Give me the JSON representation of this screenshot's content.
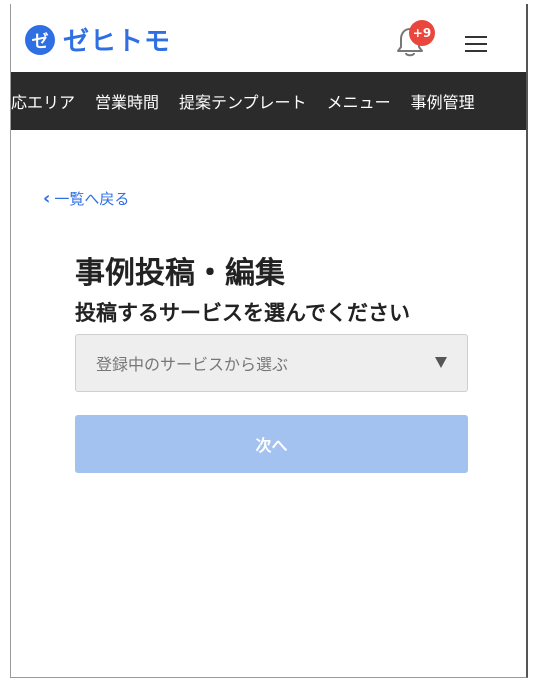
{
  "header": {
    "logo_mark": "ゼ",
    "logo_text": "ゼヒトモ",
    "notification_badge": "+9",
    "icons": [
      "bell-icon",
      "menu-icon"
    ]
  },
  "nav": {
    "items": [
      "対応エリア",
      "営業時間",
      "提案テンプレート",
      "メニュー",
      "事例管理"
    ]
  },
  "content": {
    "back_link": "一覧へ戻る",
    "title": "事例投稿・編集",
    "subtitle": "投稿するサービスを選んでください",
    "select": {
      "placeholder": "登録中のサービスから選ぶ"
    },
    "next_button": "次へ"
  },
  "colors": {
    "brand": "#2f6fe4",
    "nav_bg": "#2b2b2b",
    "badge": "#e9463e",
    "button_disabled": "#a3c2f0"
  }
}
